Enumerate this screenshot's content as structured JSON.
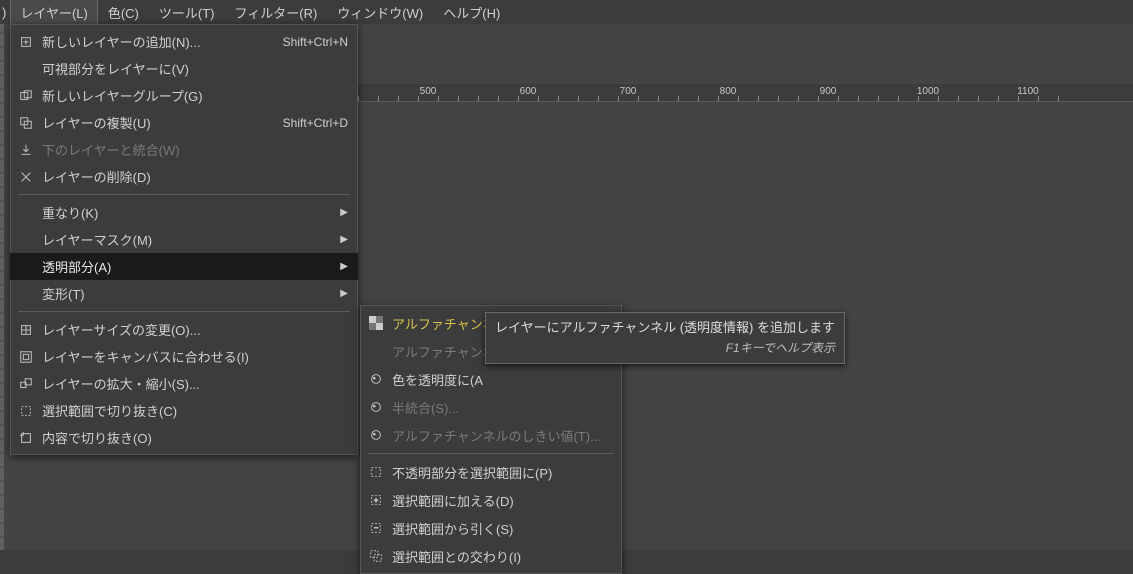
{
  "menubar": {
    "prefix": ")",
    "items": [
      {
        "label": "レイヤー(L)",
        "selected": true
      },
      {
        "label": "色(C)"
      },
      {
        "label": "ツール(T)"
      },
      {
        "label": "フィルター(R)"
      },
      {
        "label": "ウィンドウ(W)"
      },
      {
        "label": "ヘルプ(H)"
      }
    ]
  },
  "layer_menu": [
    {
      "type": "item",
      "icon": "new-layer",
      "label": "新しいレイヤーの追加(N)...",
      "shortcut": "Shift+Ctrl+N"
    },
    {
      "type": "item",
      "icon": "",
      "label": "可視部分をレイヤーに(V)"
    },
    {
      "type": "item",
      "icon": "group",
      "label": "新しいレイヤーグループ(G)"
    },
    {
      "type": "item",
      "icon": "duplicate",
      "label": "レイヤーの複製(U)",
      "shortcut": "Shift+Ctrl+D"
    },
    {
      "type": "item",
      "icon": "merge-down",
      "label": "下のレイヤーと統合(W)",
      "disabled": true
    },
    {
      "type": "item",
      "icon": "delete",
      "label": "レイヤーの削除(D)"
    },
    {
      "type": "sep"
    },
    {
      "type": "item",
      "icon": "",
      "label": "重なり(K)",
      "submenu": true
    },
    {
      "type": "item",
      "icon": "",
      "label": "レイヤーマスク(M)",
      "submenu": true
    },
    {
      "type": "item",
      "icon": "",
      "label": "透明部分(A)",
      "submenu": true,
      "highlight": true
    },
    {
      "type": "item",
      "icon": "",
      "label": "変形(T)",
      "submenu": true
    },
    {
      "type": "sep"
    },
    {
      "type": "item",
      "icon": "resize",
      "label": "レイヤーサイズの変更(O)..."
    },
    {
      "type": "item",
      "icon": "fit-canvas",
      "label": "レイヤーをキャンバスに合わせる(I)"
    },
    {
      "type": "item",
      "icon": "scale",
      "label": "レイヤーの拡大・縮小(S)..."
    },
    {
      "type": "item",
      "icon": "crop-sel",
      "label": "選択範囲で切り抜き(C)"
    },
    {
      "type": "item",
      "icon": "crop-content",
      "label": "内容で切り抜き(O)"
    }
  ],
  "transparency_submenu": [
    {
      "type": "item",
      "icon": "checker",
      "label": "アルファチャンネルの追加(H)",
      "hot": true
    },
    {
      "type": "item",
      "icon": "",
      "label": "アルファチャンネルの削除(R)",
      "disabled": true,
      "truncated": "アルファチャンネル"
    },
    {
      "type": "item",
      "icon": "gimp",
      "label": "色を透明度に(A)...",
      "truncated": "色を透明度に(A"
    },
    {
      "type": "item",
      "icon": "gimp",
      "label": "半統合(S)...",
      "disabled": true
    },
    {
      "type": "item",
      "icon": "gimp",
      "label": "アルファチャンネルのしきい値(T)...",
      "disabled": true
    },
    {
      "type": "sep"
    },
    {
      "type": "item",
      "icon": "sel",
      "label": "不透明部分を選択範囲に(P)"
    },
    {
      "type": "item",
      "icon": "sel-add",
      "label": "選択範囲に加える(D)"
    },
    {
      "type": "item",
      "icon": "sel-sub",
      "label": "選択範囲から引く(S)"
    },
    {
      "type": "item",
      "icon": "sel-int",
      "label": "選択範囲との交わり(I)"
    }
  ],
  "tooltip": {
    "text": "レイヤーにアルファチャンネル (透明度情報) を追加します",
    "hint": "F1キーでヘルプ表示"
  },
  "ruler_ticks": [
    "500",
    "600",
    "700",
    "800",
    "900",
    "1000",
    "1100"
  ]
}
